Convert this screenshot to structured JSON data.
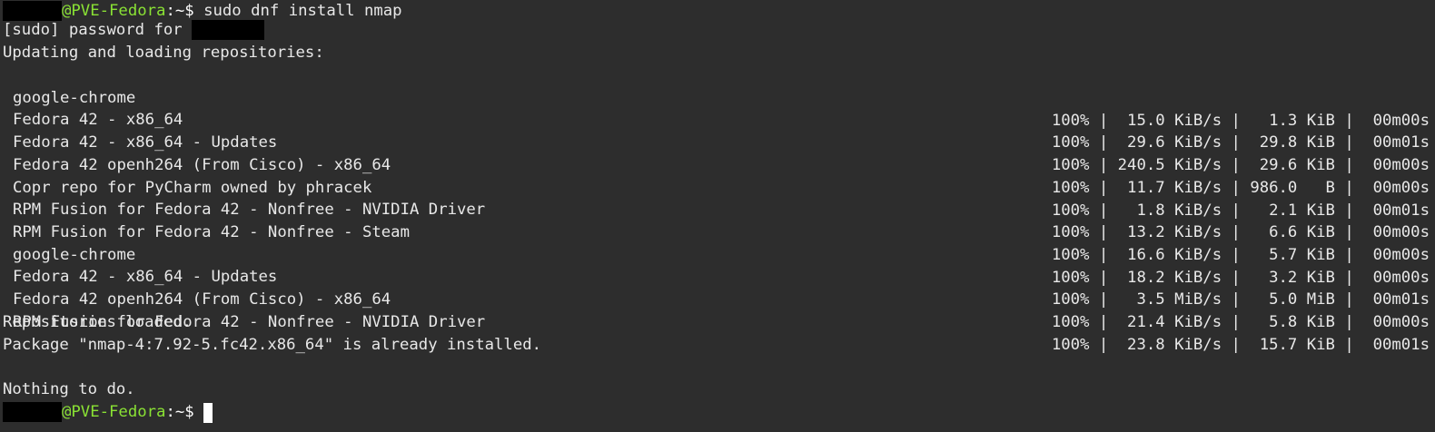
{
  "prompt": {
    "host": "@PVE-Fedora",
    "path": ":~$",
    "command": " sudo dnf install nmap"
  },
  "sudo_prompt": "[sudo] password for ",
  "status_updating": "Updating and loading repositories:",
  "repos": [
    {
      "name": "google-chrome",
      "stats": "100% |  15.0 KiB/s |   1.3 KiB |  00m00s"
    },
    {
      "name": "Fedora 42 - x86_64",
      "stats": "100% |  29.6 KiB/s |  29.8 KiB |  00m01s"
    },
    {
      "name": "Fedora 42 - x86_64 - Updates",
      "stats": "100% | 240.5 KiB/s |  29.6 KiB |  00m00s"
    },
    {
      "name": "Fedora 42 openh264 (From Cisco) - x86_64",
      "stats": "100% |  11.7 KiB/s | 986.0   B |  00m00s"
    },
    {
      "name": "Copr repo for PyCharm owned by phracek",
      "stats": "100% |   1.8 KiB/s |   2.1 KiB |  00m01s"
    },
    {
      "name": "RPM Fusion for Fedora 42 - Nonfree - NVIDIA Driver",
      "stats": "100% |  13.2 KiB/s |   6.6 KiB |  00m00s"
    },
    {
      "name": "RPM Fusion for Fedora 42 - Nonfree - Steam",
      "stats": "100% |  16.6 KiB/s |   5.7 KiB |  00m00s"
    },
    {
      "name": "google-chrome",
      "stats": "100% |  18.2 KiB/s |   3.2 KiB |  00m00s"
    },
    {
      "name": "Fedora 42 - x86_64 - Updates",
      "stats": "100% |   3.5 MiB/s |   5.0 MiB |  00m01s"
    },
    {
      "name": "Fedora 42 openh264 (From Cisco) - x86_64",
      "stats": "100% |  21.4 KiB/s |   5.8 KiB |  00m00s"
    },
    {
      "name": "RPM Fusion for Fedora 42 - Nonfree - NVIDIA Driver",
      "stats": "100% |  23.8 KiB/s |  15.7 KiB |  00m01s"
    }
  ],
  "status_loaded": "Repositories loaded.",
  "status_installed": "Package \"nmap-4:7.92-5.fc42.x86_64\" is already installed.",
  "status_nothing": "Nothing to do.",
  "prompt2": {
    "host": "@PVE-Fedora",
    "path": ":~$"
  }
}
